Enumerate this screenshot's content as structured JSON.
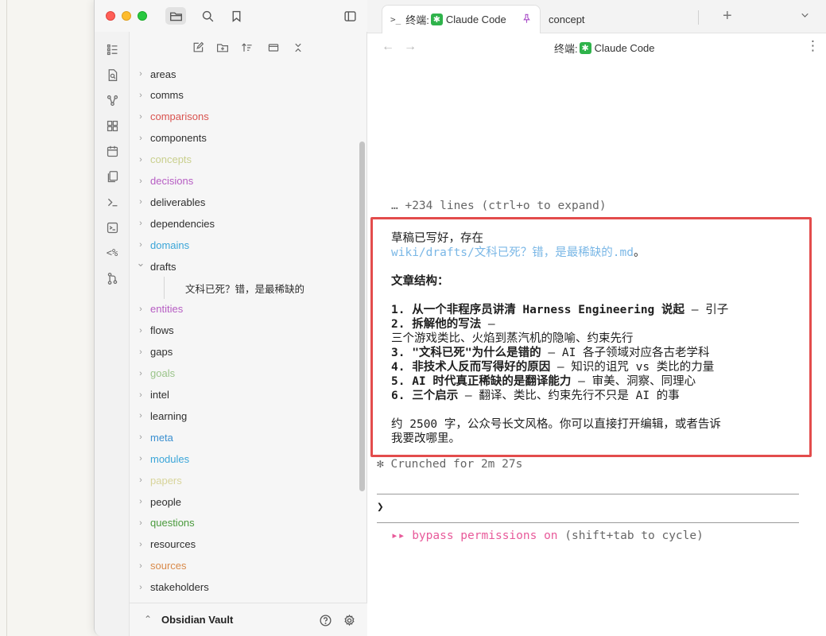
{
  "sidebar_tree": {
    "items": [
      {
        "label": "areas",
        "color": "#2e2e2e"
      },
      {
        "label": "comms",
        "color": "#2e2e2e"
      },
      {
        "label": "comparisons",
        "color": "#d9534f"
      },
      {
        "label": "components",
        "color": "#2e2e2e"
      },
      {
        "label": "concepts",
        "color": "#c9cf8d"
      },
      {
        "label": "decisions",
        "color": "#b65dc3"
      },
      {
        "label": "deliverables",
        "color": "#2e2e2e"
      },
      {
        "label": "dependencies",
        "color": "#2e2e2e"
      },
      {
        "label": "domains",
        "color": "#3aa5d8"
      },
      {
        "label": "drafts",
        "color": "#2e2e2e"
      },
      {
        "label": "entities",
        "color": "#b65dc3"
      },
      {
        "label": "flows",
        "color": "#2e2e2e"
      },
      {
        "label": "gaps",
        "color": "#2e2e2e"
      },
      {
        "label": "goals",
        "color": "#9bc48a"
      },
      {
        "label": "intel",
        "color": "#2e2e2e"
      },
      {
        "label": "learning",
        "color": "#2e2e2e"
      },
      {
        "label": "meta",
        "color": "#3a8fd0"
      },
      {
        "label": "modules",
        "color": "#3aa5d8"
      },
      {
        "label": "papers",
        "color": "#d8d49a"
      },
      {
        "label": "people",
        "color": "#2e2e2e"
      },
      {
        "label": "questions",
        "color": "#4a9a3c"
      },
      {
        "label": "resources",
        "color": "#2e2e2e"
      },
      {
        "label": "sources",
        "color": "#d98a4a"
      },
      {
        "label": "stakeholders",
        "color": "#2e2e2e"
      }
    ],
    "drafts_child": "文科已死？错，是最稀缺的"
  },
  "vault": {
    "name": "Obsidian Vault"
  },
  "tabs": {
    "active_prefix": "终端:",
    "active_label": "Claude Code",
    "inactive_label": "concept",
    "star_glyph": "✱"
  },
  "nav": {
    "title_prefix": "终端:",
    "title_label": "Claude Code"
  },
  "terminal": {
    "collapsed": "… +234 lines (ctrl+o to expand)",
    "line1": "草稿已写好，存在",
    "path": "wiki/drafts/文科已死？错，是最稀缺的.md",
    "path_end": "。",
    "structure_heading": "文章结构：",
    "s1_bold": "1. 从一个非程序员讲清 Harness Engineering 说起",
    "s1_rest": " — 引子",
    "s2_bold": "2. 拆解他的写法",
    "s2_rest": " —",
    "s2_cont": "三个游戏类比、火焰到蒸汽机的隐喻、约束先行",
    "s3_bold": "3. \"文科已死\"为什么是错的",
    "s3_rest": " — AI 各子领域对应各古老学科",
    "s4_bold": "4. 非技术人反而写得好的原因",
    "s4_rest": " — 知识的诅咒 vs 类比的力量",
    "s5_bold": "5. AI 时代真正稀缺的是翻译能力",
    "s5_rest": " — 审美、洞察、同理心",
    "s6_bold": "6. 三个启示",
    "s6_rest": " — 翻译、类比、约束先行不只是 AI 的事",
    "summary1": "约 2500 字，公众号长文风格。你可以直接打开编辑，或者告诉",
    "summary2": "我要改哪里。",
    "crunched": "✻ Crunched for 2m 27s",
    "prompt": "❯",
    "bypass_arrows": "▸▸ ",
    "bypass_text": "bypass permissions on",
    "bypass_hint": " (shift+tab to cycle)"
  }
}
